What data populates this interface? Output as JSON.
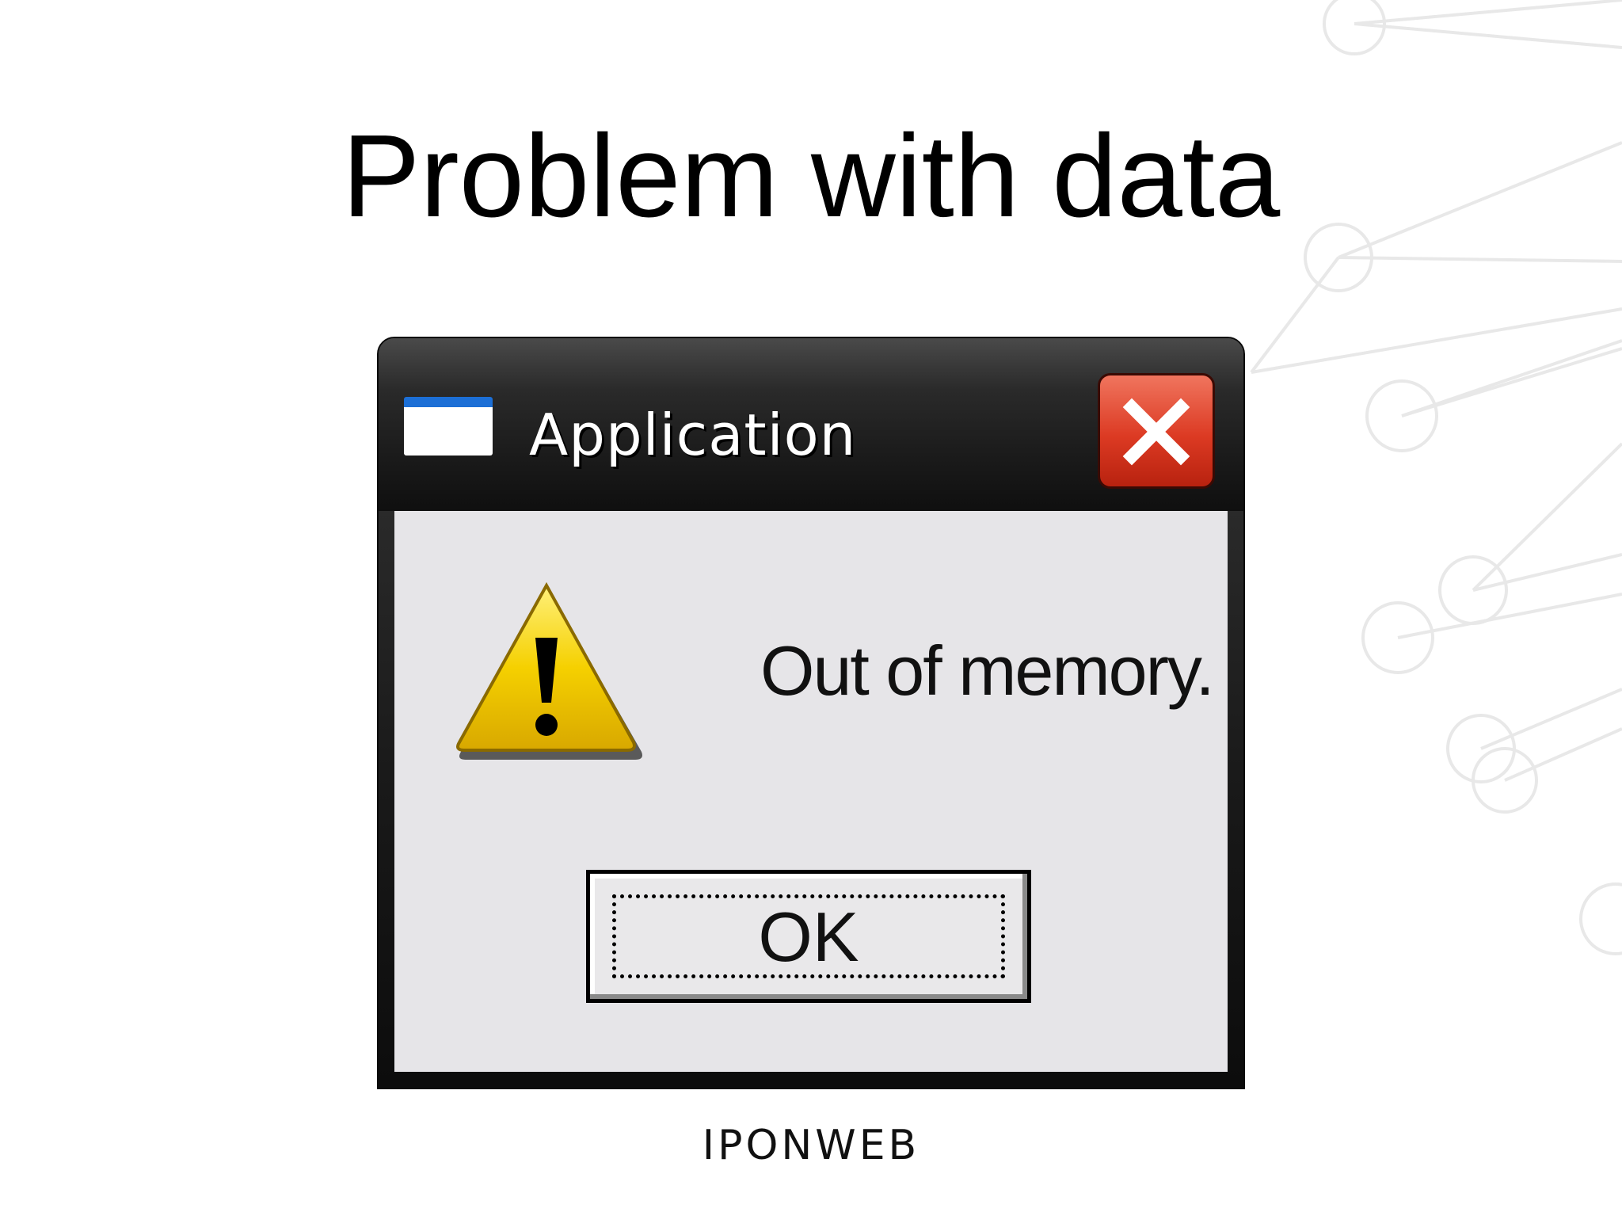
{
  "slide": {
    "title": "Problem with data",
    "brand": "IPONWEB"
  },
  "dialog": {
    "title": "Application",
    "message": "Out of memory.",
    "ok_label": "OK",
    "icons": {
      "app": "window-icon",
      "close": "close-icon",
      "warning": "warning-icon"
    }
  },
  "colors": {
    "close_button": "#dc3a23",
    "app_icon_bar": "#1c6fd6",
    "warning_fill": "#f5d000",
    "client_area": "#e6e5e8"
  }
}
